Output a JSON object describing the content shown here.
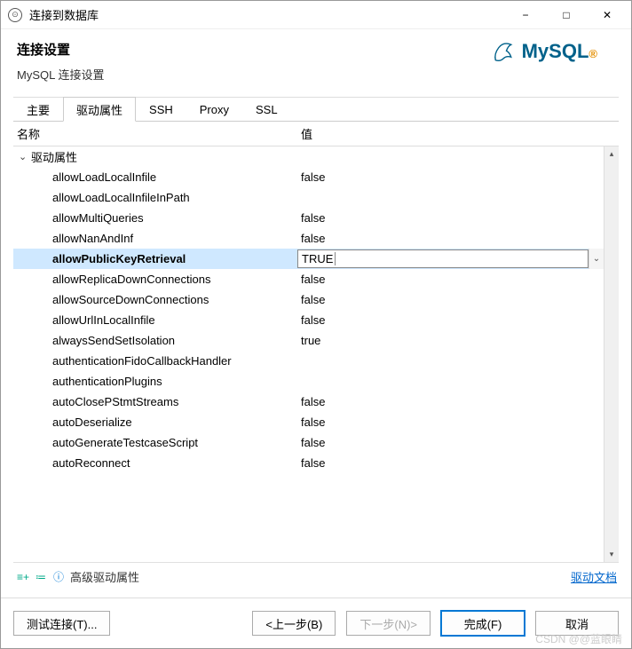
{
  "window": {
    "title": "连接到数据库",
    "minimize": "−",
    "maximize": "□",
    "close": "✕"
  },
  "header": {
    "title": "连接设置",
    "subtitle": "MySQL 连接设置",
    "logo_text": "MySQL",
    "logo_tm": "®"
  },
  "tabs": [
    {
      "label": "主要",
      "active": false
    },
    {
      "label": "驱动属性",
      "active": true
    },
    {
      "label": "SSH",
      "active": false
    },
    {
      "label": "Proxy",
      "active": false
    },
    {
      "label": "SSL",
      "active": false
    }
  ],
  "columns": {
    "name": "名称",
    "value": "值"
  },
  "group": {
    "caret": "⌄",
    "label": "驱动属性"
  },
  "properties": [
    {
      "name": "allowLoadLocalInfile",
      "value": "false",
      "selected": false
    },
    {
      "name": "allowLoadLocalInfileInPath",
      "value": "",
      "selected": false
    },
    {
      "name": "allowMultiQueries",
      "value": "false",
      "selected": false
    },
    {
      "name": "allowNanAndInf",
      "value": "false",
      "selected": false
    },
    {
      "name": "allowPublicKeyRetrieval",
      "value": "TRUE",
      "selected": true
    },
    {
      "name": "allowReplicaDownConnections",
      "value": "false",
      "selected": false
    },
    {
      "name": "allowSourceDownConnections",
      "value": "false",
      "selected": false
    },
    {
      "name": "allowUrlInLocalInfile",
      "value": "false",
      "selected": false
    },
    {
      "name": "alwaysSendSetIsolation",
      "value": "true",
      "selected": false
    },
    {
      "name": "authenticationFidoCallbackHandler",
      "value": "",
      "selected": false
    },
    {
      "name": "authenticationPlugins",
      "value": "",
      "selected": false
    },
    {
      "name": "autoClosePStmtStreams",
      "value": "false",
      "selected": false
    },
    {
      "name": "autoDeserialize",
      "value": "false",
      "selected": false
    },
    {
      "name": "autoGenerateTestcaseScript",
      "value": "false",
      "selected": false
    },
    {
      "name": "autoReconnect",
      "value": "false",
      "selected": false
    }
  ],
  "selected_dropdown": "⌄",
  "footer": {
    "advanced_label": "高级驱动属性",
    "docs_link": "驱动文档"
  },
  "buttons": {
    "test": "测试连接(T)...",
    "back": "<上一步(B)",
    "next": "下一步(N)>",
    "finish": "完成(F)",
    "cancel": "取消"
  },
  "watermark": "CSDN @@蓝眼睛"
}
